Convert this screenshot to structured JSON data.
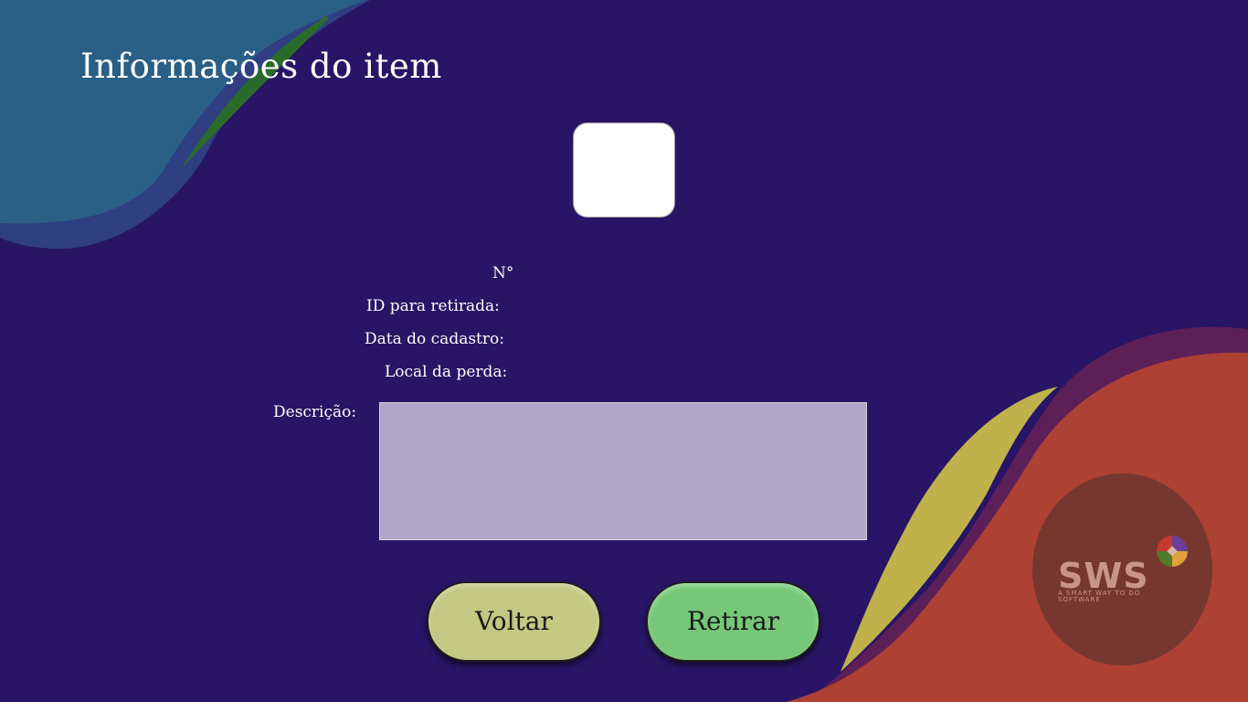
{
  "page": {
    "title": "Informações do item"
  },
  "fields": {
    "number_label": "N°",
    "withdrawal_id_label": "ID para retirada:",
    "registration_date_label": "Data do cadastro:",
    "loss_location_label": "Local da perda:",
    "description_label": "Descrição:"
  },
  "buttons": {
    "back_label": "Voltar",
    "withdraw_label": "Retirar"
  },
  "logo": {
    "name": "SWS",
    "tagline": "A SMART WAY TO DO SOFTWARE"
  },
  "colors": {
    "background": "#281565",
    "back_button": "#c3c883",
    "withdraw_button": "#76c878",
    "description_box": "#afa7c7"
  }
}
